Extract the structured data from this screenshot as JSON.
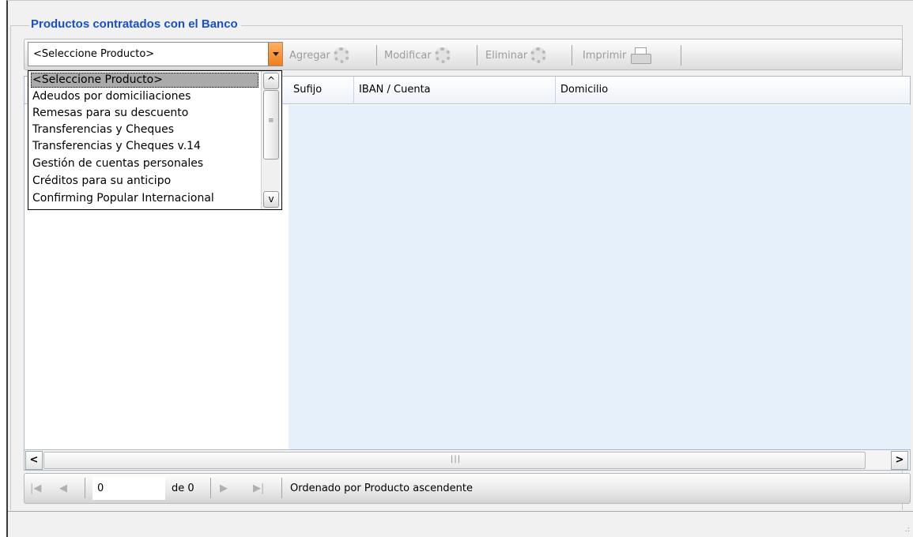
{
  "group": {
    "title": "Productos contratados con el Banco"
  },
  "toolbar": {
    "product_combo_value": "<Seleccione Producto>",
    "add_label": "Agregar",
    "modify_label": "Modificar",
    "delete_label": "Eliminar",
    "print_label": "Imprimir"
  },
  "grid": {
    "columns": [
      "Sufijo",
      "IBAN / Cuenta",
      "Domicilio"
    ]
  },
  "dropdown": {
    "items": [
      "<Seleccione Producto>",
      "Adeudos por domiciliaciones",
      "Remesas para su descuento",
      "Transferencias y Cheques",
      "Transferencias y Cheques v.14",
      "Gestión de cuentas personales",
      "Créditos para su anticipo",
      "Confirming Popular Internacional"
    ]
  },
  "navigator": {
    "position_value": "0",
    "total_label": "de 0",
    "sort_status": "Ordenado por Producto ascendente"
  },
  "icons": {
    "combo_dropdown": "chevron-down-icon",
    "add": "gear-add-icon",
    "modify": "gear-edit-icon",
    "delete": "gear-delete-icon",
    "print": "printer-icon",
    "first": "first-page-icon",
    "prev": "prev-page-icon",
    "next": "next-page-icon",
    "last": "last-page-icon"
  },
  "colors": {
    "title": "#1750c8",
    "combo_button": "#ef7e1d",
    "grid_body": "#e6f0fb",
    "selected_item": "#aaaaaa"
  }
}
